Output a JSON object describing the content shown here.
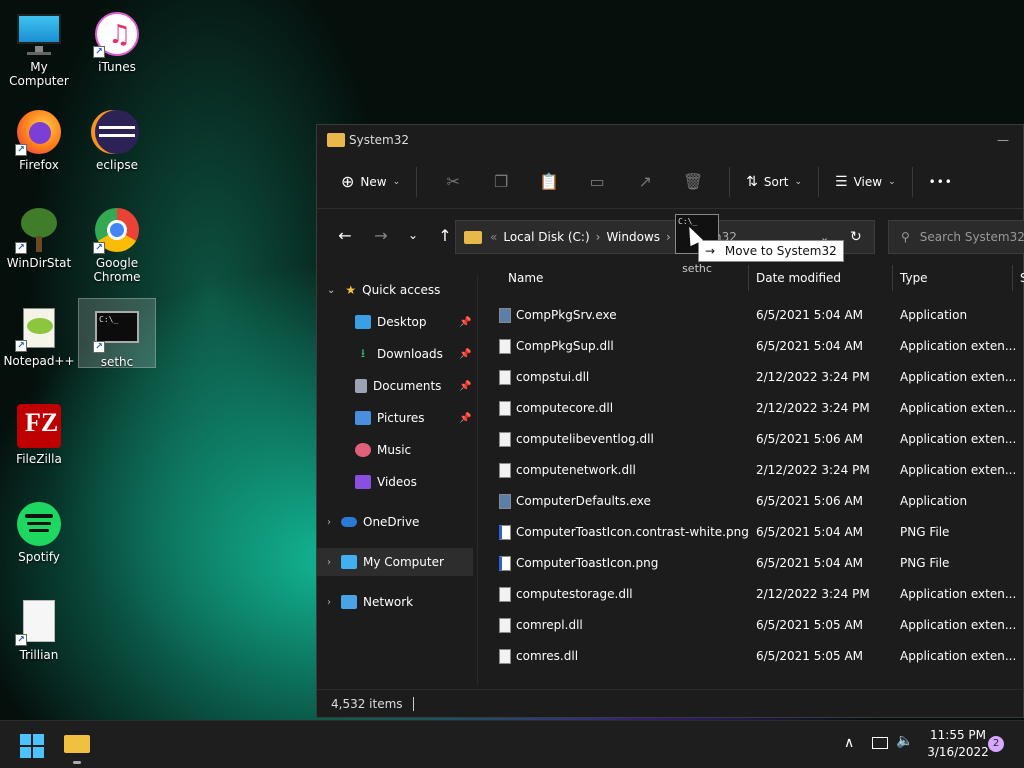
{
  "desktop": {
    "icons": [
      {
        "label": "My Computer",
        "icon": "monitor-icon"
      },
      {
        "label": "iTunes",
        "icon": "itunes-icon"
      },
      {
        "label": "Firefox",
        "icon": "firefox-icon"
      },
      {
        "label": "eclipse",
        "icon": "eclipse-icon"
      },
      {
        "label": "WinDirStat",
        "icon": "windirstat-icon"
      },
      {
        "label": "Google Chrome",
        "icon": "chrome-icon"
      },
      {
        "label": "Notepad++",
        "icon": "notepadpp-icon"
      },
      {
        "label": "sethc",
        "icon": "cmd-icon"
      },
      {
        "label": "FileZilla",
        "icon": "filezilla-icon"
      },
      {
        "label": "Spotify",
        "icon": "spotify-icon"
      },
      {
        "label": "Trillian",
        "icon": "blank-file-icon"
      }
    ]
  },
  "explorer": {
    "title": "System32",
    "toolbar": {
      "new_label": "New",
      "sort_label": "Sort",
      "view_label": "View",
      "more_label": "•••"
    },
    "address": {
      "crumb1": "Local Disk (C:)",
      "crumb2": "Windows",
      "crumb3": "System32"
    },
    "search_placeholder": "Search System32",
    "nav": {
      "quick_access": "Quick access",
      "items": [
        "Desktop",
        "Downloads",
        "Documents",
        "Pictures",
        "Music",
        "Videos"
      ],
      "onedrive": "OneDrive",
      "my_computer": "My Computer",
      "network": "Network"
    },
    "columns": {
      "name": "Name",
      "date": "Date modified",
      "type": "Type",
      "size": "S"
    },
    "files": [
      {
        "name": "CompPkgSrv.exe",
        "date": "6/5/2021 5:04 AM",
        "type": "Application",
        "kind": "exe"
      },
      {
        "name": "CompPkgSup.dll",
        "date": "6/5/2021 5:04 AM",
        "type": "Application exten...",
        "kind": "dll"
      },
      {
        "name": "compstui.dll",
        "date": "2/12/2022 3:24 PM",
        "type": "Application exten...",
        "kind": "dll"
      },
      {
        "name": "computecore.dll",
        "date": "2/12/2022 3:24 PM",
        "type": "Application exten...",
        "kind": "dll"
      },
      {
        "name": "computelibeventlog.dll",
        "date": "6/5/2021 5:06 AM",
        "type": "Application exten...",
        "kind": "dll"
      },
      {
        "name": "computenetwork.dll",
        "date": "2/12/2022 3:24 PM",
        "type": "Application exten...",
        "kind": "dll"
      },
      {
        "name": "ComputerDefaults.exe",
        "date": "6/5/2021 5:06 AM",
        "type": "Application",
        "kind": "exe"
      },
      {
        "name": "ComputerToastIcon.contrast-white.png",
        "date": "6/5/2021 5:04 AM",
        "type": "PNG File",
        "kind": "png"
      },
      {
        "name": "ComputerToastIcon.png",
        "date": "6/5/2021 5:04 AM",
        "type": "PNG File",
        "kind": "png"
      },
      {
        "name": "computestorage.dll",
        "date": "2/12/2022 3:24 PM",
        "type": "Application exten...",
        "kind": "dll"
      },
      {
        "name": "comrepl.dll",
        "date": "6/5/2021 5:05 AM",
        "type": "Application exten...",
        "kind": "dll"
      },
      {
        "name": "comres.dll",
        "date": "6/5/2021 5:05 AM",
        "type": "Application exten...",
        "kind": "dll"
      }
    ],
    "status": "4,532 items"
  },
  "drag": {
    "ghost_text": "C:\\_",
    "label": "sethc",
    "tooltip": "Move to System32"
  },
  "taskbar": {
    "time": "11:55 PM",
    "date": "3/16/2022",
    "notifications": "2"
  }
}
